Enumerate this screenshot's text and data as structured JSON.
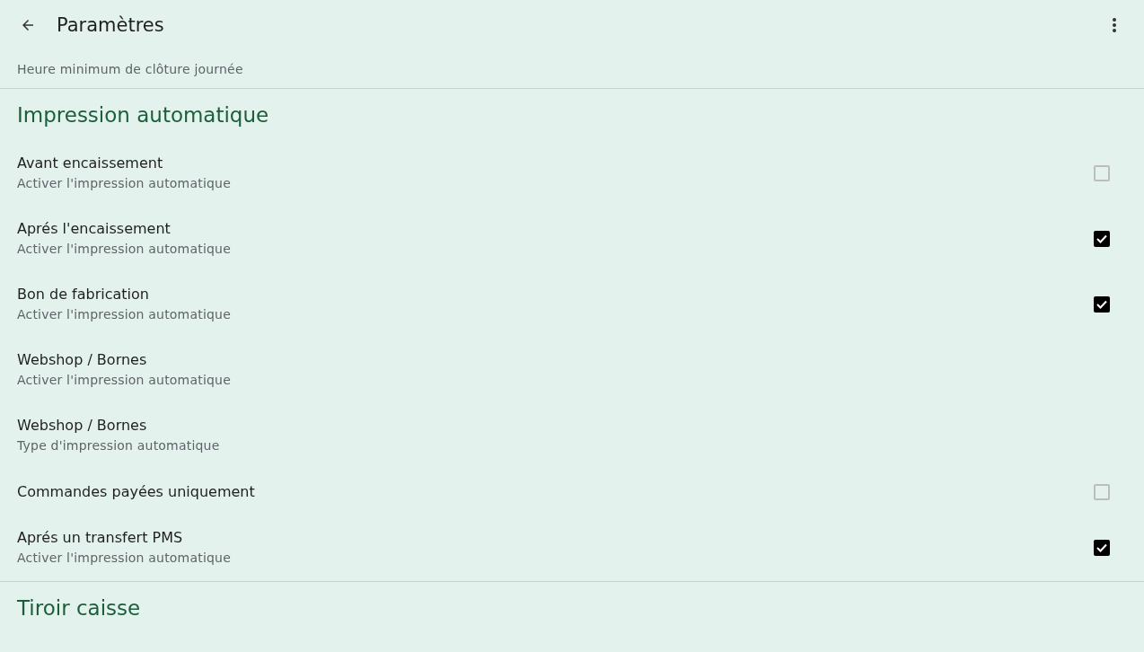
{
  "app_bar": {
    "title": "Paramètres"
  },
  "top_item": {
    "subtitle": "Heure minimum de clôture journée"
  },
  "sections": [
    {
      "title": "Impression automatique",
      "items": [
        {
          "kind": "checkbox",
          "title": "Avant encaissement",
          "subtitle": "Activer l'impression automatique",
          "checked": false
        },
        {
          "kind": "checkbox",
          "title": "Aprés l'encaissement",
          "subtitle": "Activer l'impression automatique",
          "checked": true
        },
        {
          "kind": "checkbox",
          "title": "Bon de fabrication",
          "subtitle": "Activer l'impression automatique",
          "checked": true
        },
        {
          "kind": "plain",
          "title": "Webshop / Bornes",
          "subtitle": "Activer l'impression automatique"
        },
        {
          "kind": "plain",
          "title": "Webshop / Bornes",
          "subtitle": "Type d'impression automatique"
        },
        {
          "kind": "checkbox",
          "title": "Commandes payées uniquement",
          "checked": false
        },
        {
          "kind": "checkbox",
          "title": "Aprés un transfert PMS",
          "subtitle": "Activer l'impression automatique",
          "checked": true
        }
      ]
    },
    {
      "title": "Tiroir caisse"
    }
  ]
}
